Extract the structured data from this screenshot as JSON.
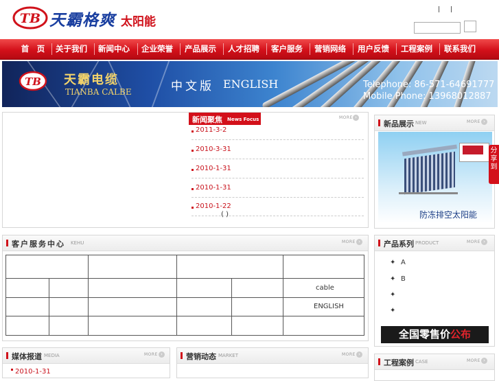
{
  "header": {
    "brand_name": "天霸格爽",
    "brand_suffix": "太阳能",
    "logo_text": "TB"
  },
  "nav": {
    "items": [
      "首　页",
      "关于我们",
      "新闻中心",
      "企业荣誉",
      "产品展示",
      "人才招聘",
      "客户服务",
      "营销网络",
      "用户反馈",
      "工程案例",
      "联系我们"
    ]
  },
  "banner": {
    "company_cn": "天霸电缆",
    "company_en": "TIANBA CALBE",
    "lang_cn": "中文版",
    "lang_en": "ENGLISH",
    "telephone": "Telephone: 86-571-64691777",
    "mobile": "Mobile Phone: 13968012887"
  },
  "news": {
    "tab_cn": "新闻聚焦",
    "tab_en": "News Focus",
    "more": "MORE",
    "items": [
      {
        "date": "2011-3-2"
      },
      {
        "date": "2010-3-31"
      },
      {
        "date": "2010-1-31"
      },
      {
        "date": "2010-1-31"
      },
      {
        "date": "2010-1-22"
      }
    ],
    "pager": "( )"
  },
  "new_products": {
    "title": "新品展示",
    "title_en": "NEW",
    "more": "MORE",
    "image_caption": "防冻排空太阳能"
  },
  "service": {
    "title": "客户服务中心",
    "title_en": "KEHU",
    "more": "MORE",
    "cell_cable": "cable",
    "cell_english": "ENGLISH"
  },
  "product_series": {
    "title": "产品系列",
    "title_en": "PRODUCT",
    "more": "MORE",
    "items": [
      {
        "bullet": "✦",
        "label": "A"
      },
      {
        "bullet": "✦",
        "label": "B"
      },
      {
        "bullet": "✦",
        "label": ""
      },
      {
        "bullet": "✦",
        "label": ""
      }
    ]
  },
  "retail_banner": {
    "text_a": "全国零售价",
    "text_b": "公布"
  },
  "share": {
    "label": "分享到"
  },
  "media": {
    "title": "媒体报道",
    "title_en": "MEDIA",
    "more": "MORE",
    "first_date": "2010-1-31"
  },
  "marketing": {
    "title": "营销动态",
    "title_en": "MARKET",
    "more": "MORE"
  },
  "cases": {
    "title": "工程案例",
    "title_en": "CASE",
    "more": "MORE"
  }
}
